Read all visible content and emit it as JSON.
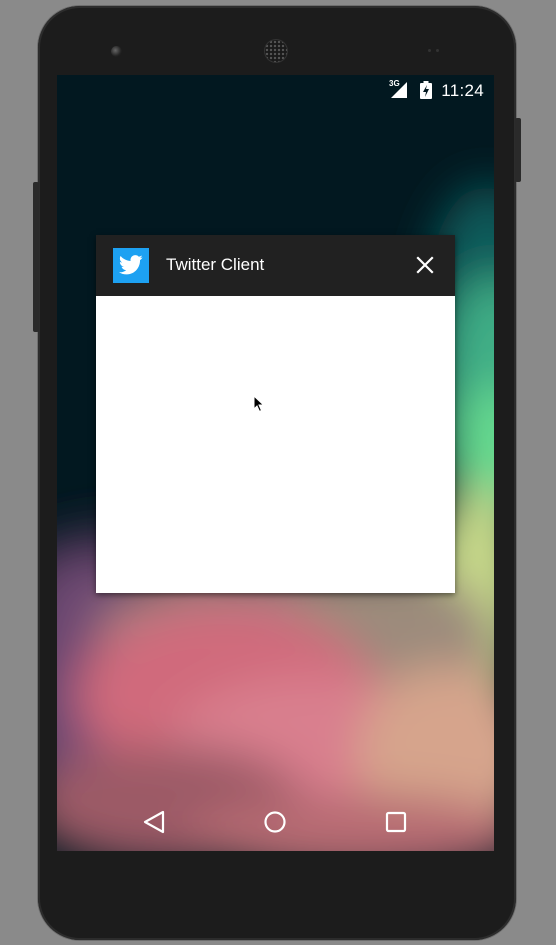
{
  "status_bar": {
    "network": "3G",
    "time": "11:24"
  },
  "dialog": {
    "app_icon": "twitter-bird-icon",
    "title": "Twitter Client",
    "close_icon": "close-icon"
  },
  "navigation": {
    "back_icon": "back-icon",
    "home_icon": "home-icon",
    "recents_icon": "recents-icon"
  },
  "colors": {
    "dialog_header": "#212121",
    "twitter_blue": "#1da1f2",
    "screen_background": "#021820"
  }
}
